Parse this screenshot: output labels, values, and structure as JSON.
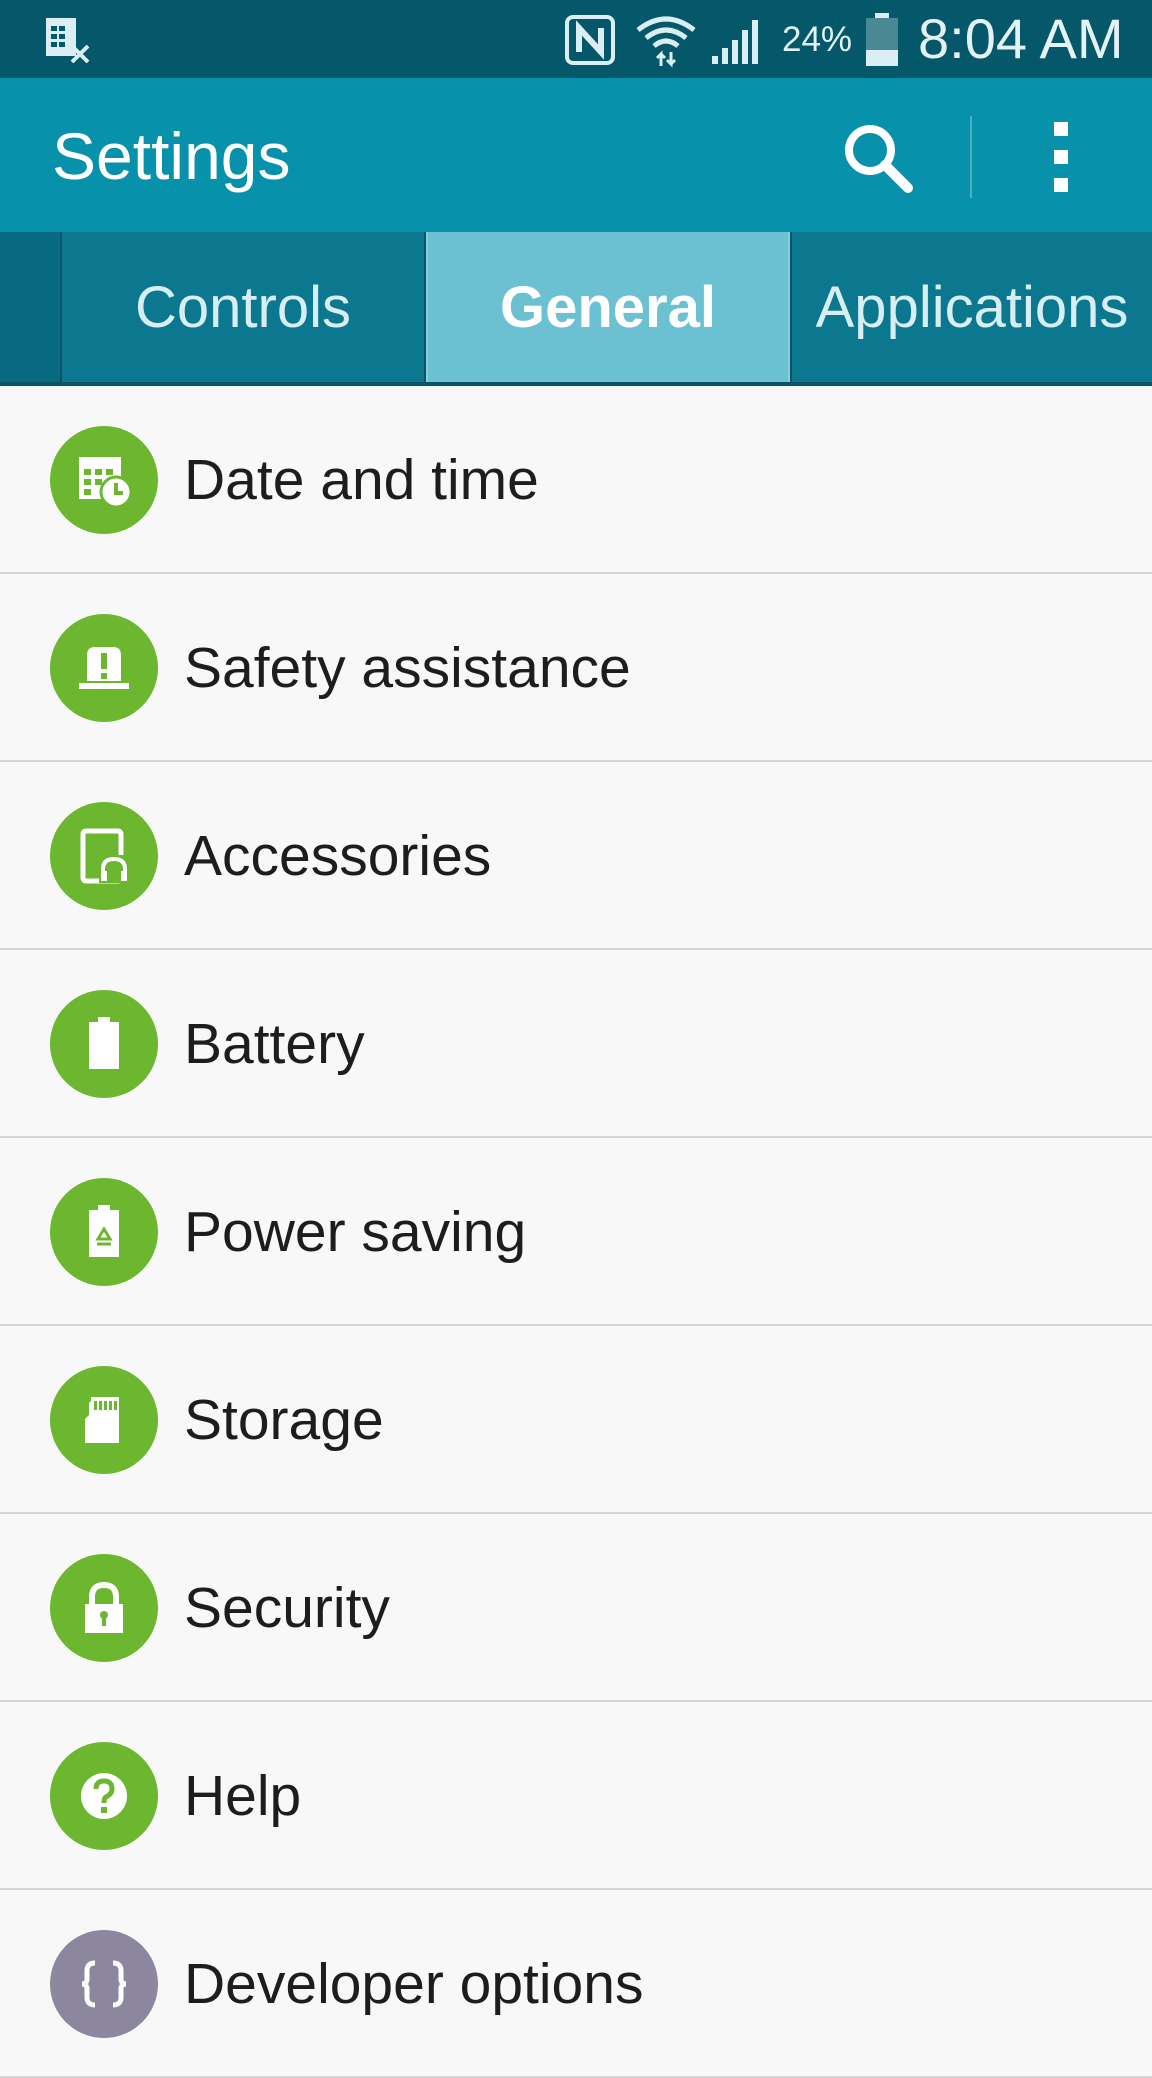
{
  "status_bar": {
    "battery_percent": "24%",
    "time": "8:04 AM",
    "icons": [
      "sim-manager-icon",
      "nfc-icon",
      "wifi-icon",
      "signal-icon",
      "battery-icon"
    ]
  },
  "action_bar": {
    "title": "Settings",
    "icons": [
      "search-icon",
      "overflow-menu-icon"
    ]
  },
  "tabs": [
    {
      "label": "Controls",
      "selected": false
    },
    {
      "label": "General",
      "selected": true
    },
    {
      "label": "Applications",
      "selected": false
    }
  ],
  "list": {
    "items": [
      {
        "label": "Date and time",
        "icon": "calendar-clock-icon"
      },
      {
        "label": "Safety assistance",
        "icon": "alarm-light-icon"
      },
      {
        "label": "Accessories",
        "icon": "accessories-icon"
      },
      {
        "label": "Battery",
        "icon": "battery-icon"
      },
      {
        "label": "Power saving",
        "icon": "power-saving-icon"
      },
      {
        "label": "Storage",
        "icon": "sd-card-icon"
      },
      {
        "label": "Security",
        "icon": "lock-icon"
      },
      {
        "label": "Help",
        "icon": "help-icon"
      },
      {
        "label": "Developer options",
        "icon": "braces-icon"
      }
    ]
  },
  "colors": {
    "status_bar": "#05576a",
    "action_bar": "#0891ab",
    "tab_bar": "#0b7890",
    "tab_selected": "#6bc1d1",
    "icon_green": "#6cb630",
    "icon_purple": "#8c869f"
  }
}
